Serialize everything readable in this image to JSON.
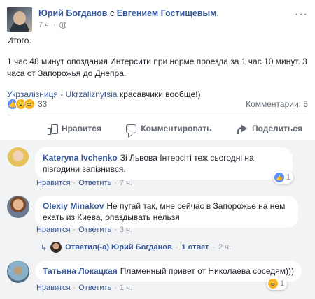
{
  "post": {
    "author": "Юрий Богданов",
    "with_text": "с",
    "tagged": "Евгением Гостищевым",
    "time": "7 ч.",
    "more": "···",
    "paragraph1": "Итого.",
    "paragraph2": "1 час 48 минут опоздания Интерсити при норме проезда за 1 час 10 минут. 3 часа от Запорожья до Днепра.",
    "page_link": "Укрзалізниця - Ukrzaliznytsia",
    "paragraph3_rest": " красавчики вообще!)",
    "reactions_count": "33",
    "comments_count": "Комментарии: 5"
  },
  "actions": {
    "like": "Нравится",
    "comment": "Комментировать",
    "share": "Поделиться"
  },
  "comments": [
    {
      "author": "Kateryna Ivchenko",
      "text": "Зі Львова Інтерсіті теж сьогодні на півгодини запізнився.",
      "like": "Нравится",
      "reply": "Ответить",
      "time": "7 ч.",
      "reaction_count": "1"
    },
    {
      "author": "Olexiy Minakov",
      "text": "Не пугай так, мне сейчас в Запорожье на нем ехать из Киева, опаздывать нельзя",
      "like": "Нравится",
      "reply": "Ответить",
      "time": "3 ч."
    },
    {
      "author": "Татьяна Локацкая",
      "text": "Пламенный привет от Николаева соседям)))",
      "like": "Нравится",
      "reply": "Ответить",
      "time": "1 ч.",
      "reaction_count": "1"
    }
  ],
  "replies": {
    "replied_by": "Ответил(-а) Юрий Богданов",
    "dot": "·",
    "count": "1 ответ",
    "time": "2 ч."
  },
  "colors": {
    "link": "#365899",
    "muted": "#90949c",
    "comment_bg": "#f2f3f5",
    "like_blue": "#5890ff",
    "emoji_yellow": "#f7b125"
  }
}
